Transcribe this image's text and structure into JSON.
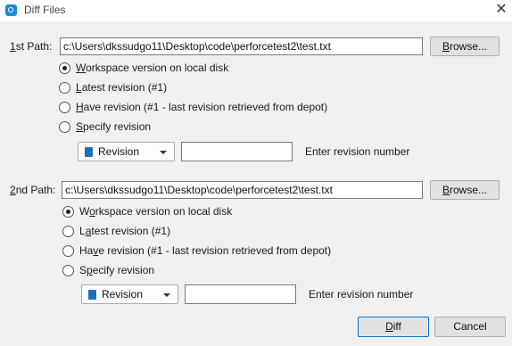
{
  "window": {
    "title": "Diff Files",
    "close_glyph": "✕"
  },
  "path1": {
    "label_prefix": "1",
    "label_rest": "st Path:",
    "value": "c:\\Users\\dkssudgo11\\Desktop\\code\\perforcetest2\\test.txt",
    "browse_label_u": "B",
    "browse_label_rest": "rowse...",
    "options": [
      {
        "u": "W",
        "rest": "orkspace version on local disk",
        "selected": true
      },
      {
        "u": "L",
        "rest": "atest revision (#1)",
        "selected": false
      },
      {
        "u": "H",
        "rest": "ave revision (#1 - last revision retrieved from depot)",
        "selected": false
      },
      {
        "u": "S",
        "rest": "pecify revision",
        "selected": false
      }
    ],
    "specifier": "Revision",
    "revision_value": "",
    "revision_hint": "Enter revision number"
  },
  "path2": {
    "label_prefix": "2",
    "label_rest": "nd Path:",
    "value": "c:\\Users\\dkssudgo11\\Desktop\\code\\perforcetest2\\test.txt",
    "browse_label_u": "B",
    "browse_label_rest": "rowse...",
    "options": [
      {
        "pre": "W",
        "u": "o",
        "rest": "rkspace version on local disk",
        "selected": true
      },
      {
        "pre": "L",
        "u": "a",
        "rest": "test revision (#1)",
        "selected": false
      },
      {
        "pre": "Ha",
        "u": "v",
        "rest": "e revision (#1 - last revision retrieved from depot)",
        "selected": false
      },
      {
        "pre": "S",
        "u": "p",
        "rest": "ecify revision",
        "selected": false
      }
    ],
    "specifier": "Revision",
    "revision_value": "",
    "revision_hint": "Enter revision number"
  },
  "footer": {
    "diff_u": "D",
    "diff_rest": "iff",
    "cancel_label": "Cancel"
  },
  "colors": {
    "accent": "#1a8ad6",
    "doc_icon": "#1d6fb8",
    "background": "#f0f0f0"
  },
  "icons": {
    "app": "diff-app-icon",
    "specifier": "document-icon",
    "dropdown": "caret-down-icon"
  }
}
